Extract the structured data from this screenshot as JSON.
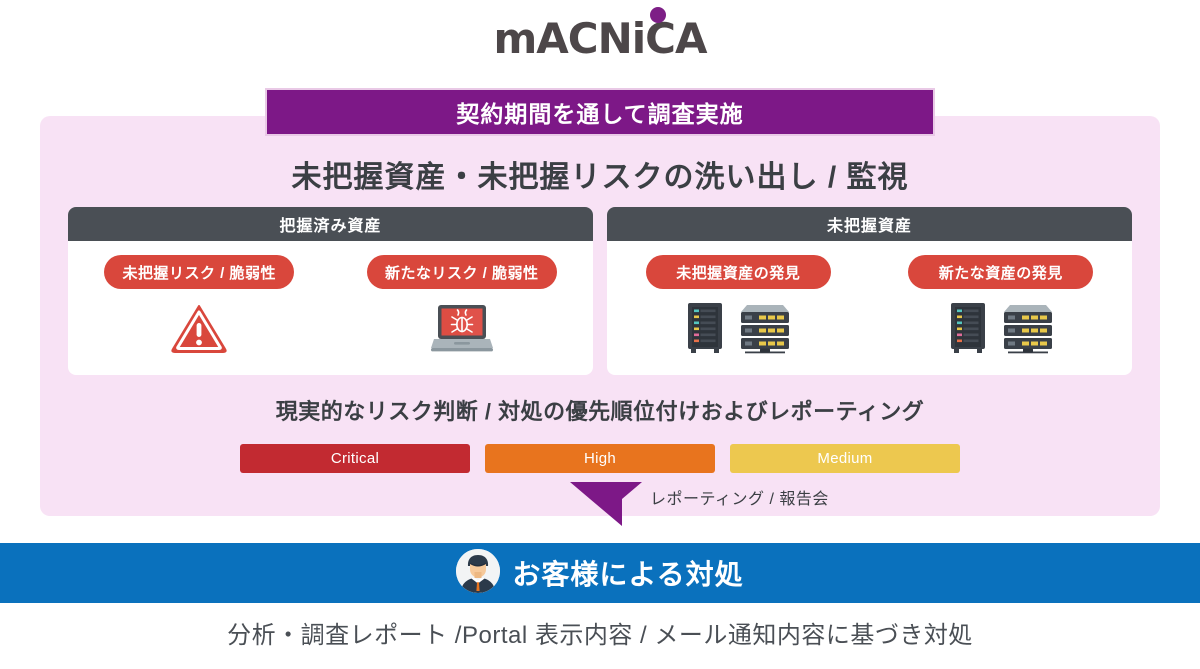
{
  "logo": {
    "text": "mACNiCA",
    "dot_color": "#7d1f86",
    "text_color": "#4d4749"
  },
  "banner": {
    "title": "契約期間を通して調査実施",
    "bg_color": "#7d1887"
  },
  "subtitle": "未把握資産・未把握リスクの洗い出し / 監視",
  "panel": {
    "bg_color": "#f8e2f5"
  },
  "cards": [
    {
      "header": "把握済み資産",
      "cells": [
        {
          "pill": "未把握リスク / 脆弱性",
          "icon": "warning-triangle-icon"
        },
        {
          "pill": "新たなリスク / 脆弱性",
          "icon": "laptop-bug-icon"
        }
      ]
    },
    {
      "header": "未把握資産",
      "cells": [
        {
          "pill": "未把握資産の発見",
          "icon": "server-rack-icon"
        },
        {
          "pill": "新たな資産の発見",
          "icon": "server-rack-icon"
        }
      ]
    }
  ],
  "priority": {
    "title": "現実的なリスク判断 / 対処の優先順位付けおよびレポーティング",
    "severities": [
      {
        "label": "Critical",
        "color": "#c22a31"
      },
      {
        "label": "High",
        "color": "#e8741e"
      },
      {
        "label": "Medium",
        "color": "#edc84f"
      }
    ]
  },
  "reporting": {
    "label": "レポーティング / 報告会",
    "arrow_color": "#7d1887",
    "arrow_icon": "down-arrow-icon"
  },
  "customer_bar": {
    "label": "お客様による対処",
    "bg_color": "#0a71bd",
    "avatar_icon": "businessman-avatar-icon"
  },
  "caption": "分析・調査レポート /Portal 表示内容 / メール通知内容に基づき対処"
}
